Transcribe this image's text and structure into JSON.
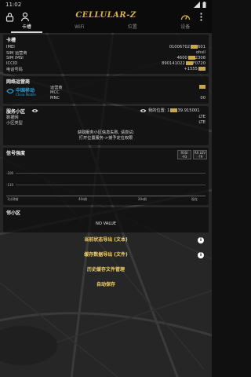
{
  "status_bar": {
    "time": "11:02"
  },
  "app": {
    "title": "CELLULAR-Z"
  },
  "tabs": [
    {
      "label": "卡槽"
    },
    {
      "label": "WiFi"
    },
    {
      "label": "位置"
    },
    {
      "label": "设备"
    }
  ],
  "sim": {
    "title": "卡槽",
    "rows": [
      {
        "k": "IMEI",
        "v": "01006702"
      },
      {
        "k": "SIM 运营商",
        "v": "ohsil"
      },
      {
        "k": "SIM IMSI",
        "v": "4600"
      },
      {
        "k": "ICCID",
        "v": "890141022"
      },
      {
        "k": "电话号码",
        "v": "+1555"
      }
    ],
    "sim_imsi_tail": "2308",
    "iccid_tail": "F0720"
  },
  "operator": {
    "title": "网络运营商",
    "logo_cn": "中国移动",
    "logo_en": "China Mobile",
    "rows": [
      {
        "k": "运营商",
        "v": ""
      },
      {
        "k": "MCC",
        "v": ""
      },
      {
        "k": "MNC",
        "v": "00"
      }
    ]
  },
  "cell": {
    "title": "服务小区",
    "location_label": "我的位置: 1",
    "location_value": "39.915001",
    "rows": [
      {
        "k": "数据网",
        "v": "LTE"
      },
      {
        "k": "小区类型",
        "v": "LTE"
      }
    ],
    "message_line1": "获取服务小区信息失败, 请尝试:",
    "message_line2": "打开位置服务->授予定位权限"
  },
  "signal": {
    "title": "信号强度",
    "metrics": [
      {
        "label": "RSSI",
        "value": "-93"
      },
      {
        "label": "RX LEV",
        "value": "-79"
      }
    ],
    "y_ticks": [
      "-100",
      "-110"
    ],
    "x_ticks": [
      "1分钟前",
      "40s前",
      "20s前",
      "现在"
    ]
  },
  "neighbor": {
    "title": "邻小区",
    "empty": "NO VALUE"
  },
  "buttons": {
    "export_current": "当前状态导出 (文本)",
    "export_cache": "缓存数据导出 (文件)",
    "history": "历史缓存文件管理",
    "autosave": "自动保存"
  },
  "colors": {
    "accent": "#d6b04a",
    "button_text": "#f2d36b",
    "card_bg": "#0c0c0c"
  }
}
